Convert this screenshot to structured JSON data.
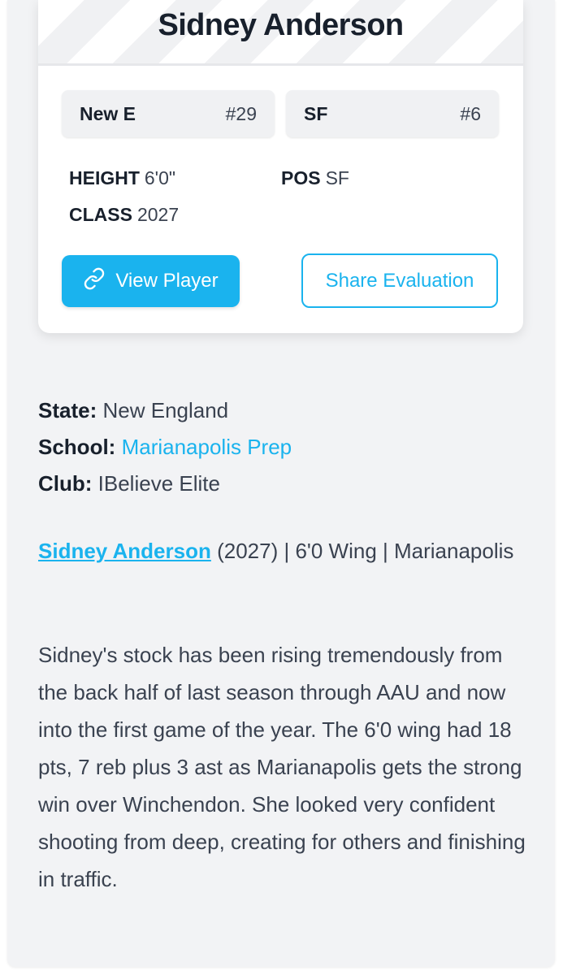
{
  "player": {
    "name": "Sidney Anderson",
    "team_chip": {
      "label": "New E",
      "number": "#29"
    },
    "position_chip": {
      "label": "SF",
      "number": "#6"
    },
    "height": {
      "label": "HEIGHT",
      "value": "6'0\""
    },
    "pos": {
      "label": "POS",
      "value": "SF"
    },
    "class": {
      "label": "CLASS",
      "value": "2027"
    }
  },
  "actions": {
    "view_player": "View Player",
    "share_evaluation": "Share Evaluation"
  },
  "details": {
    "state_label": "State:",
    "state_value": "New England",
    "school_label": "School:",
    "school_value": "Marianapolis Prep",
    "club_label": "Club:",
    "club_value": "IBelieve Elite"
  },
  "summary": {
    "name_link": "Sidney Anderson",
    "rest": " (2027) | 6'0 Wing | Marianapolis"
  },
  "evaluation": "Sidney's stock has been rising tremendously from the back half of last season through AAU and now into the first game of the year. The 6'0 wing had 18 pts, 7 reb plus 3 ast as Marianapolis gets the strong win over Winchendon. She looked very confident shooting from deep, creating for others and finishing in traffic.",
  "colors": {
    "accent": "#1ab3ee",
    "text": "#18202c",
    "muted": "#3a4250",
    "background": "#f2f3f5"
  },
  "icons": {
    "view_player": "link-icon"
  }
}
